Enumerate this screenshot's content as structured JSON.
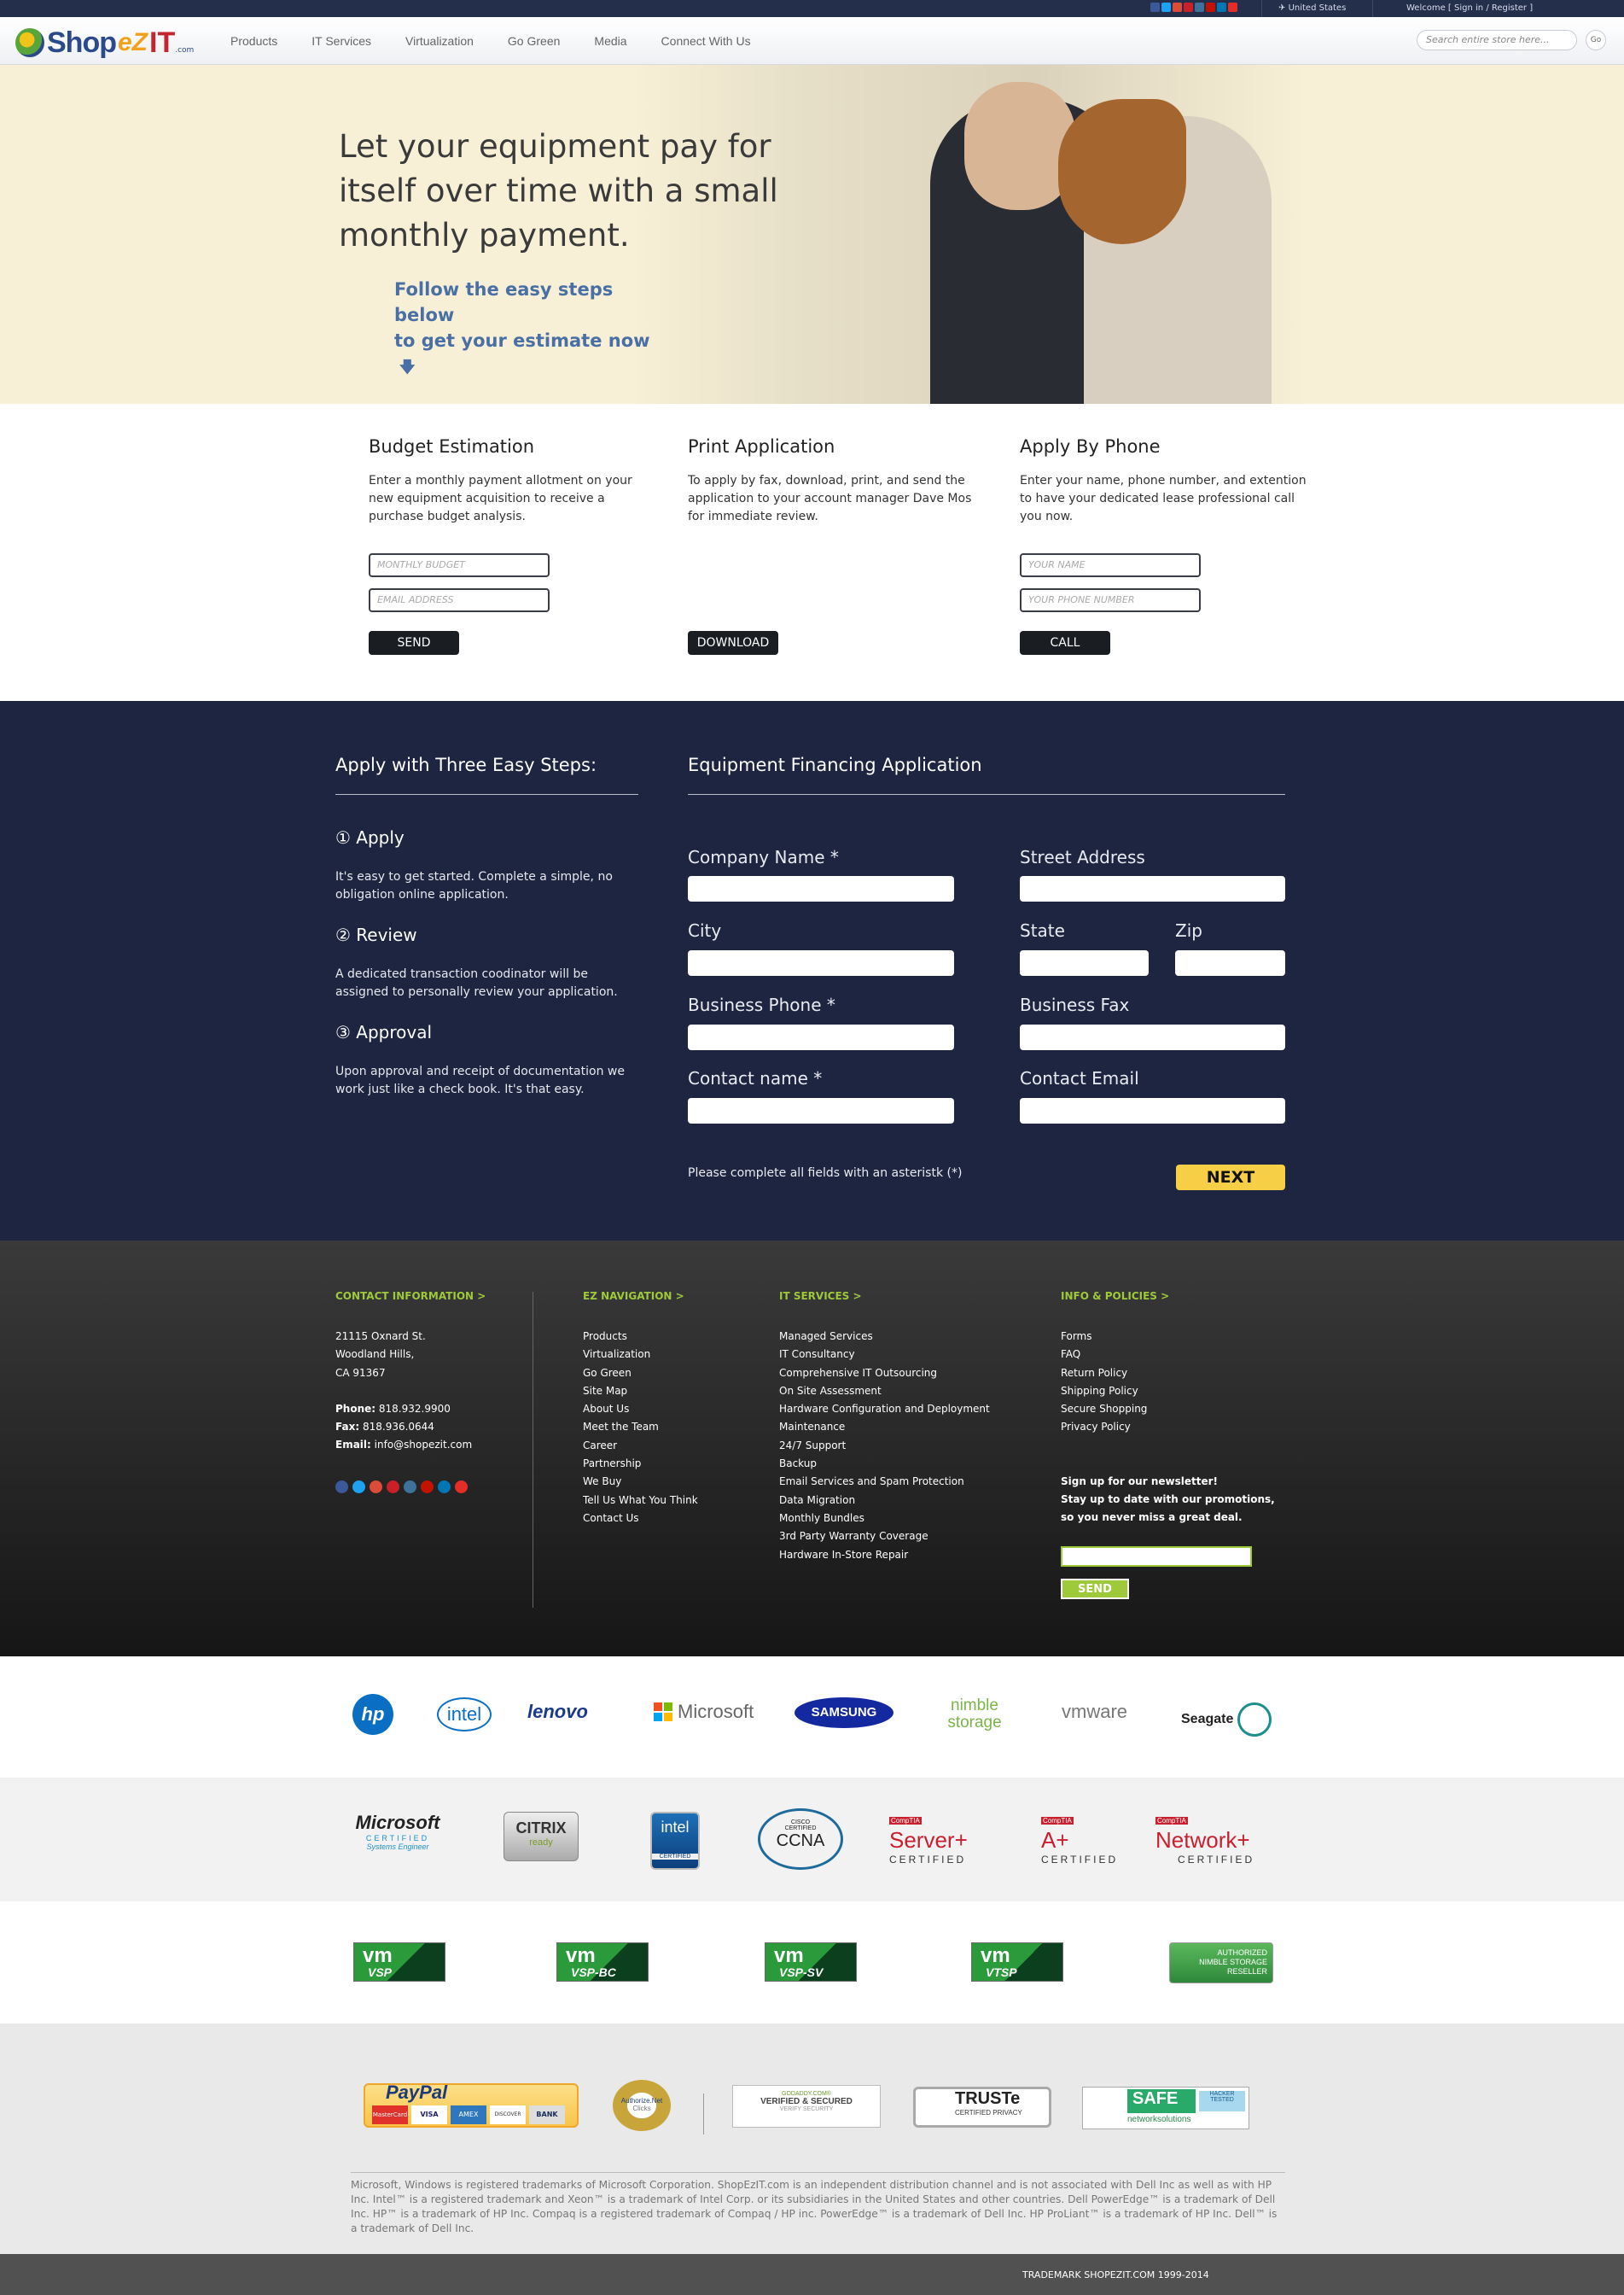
{
  "topbar": {
    "country": "United States",
    "welcome": "Welcome",
    "signin": "Sign in",
    "slash": "/",
    "register": "Register",
    "social_icons": [
      "facebook-icon",
      "twitter-icon",
      "google-plus-icon",
      "pinterest-icon",
      "instagram-icon",
      "yelp-icon",
      "linkedin-icon",
      "youtube-icon"
    ]
  },
  "header": {
    "logo_shop": "Shop",
    "logo_ez": "eZ",
    "logo_it": "IT",
    "logo_com": ".com",
    "nav": [
      "Products",
      "IT Services",
      "Virtualization",
      "Go Green",
      "Media",
      "Connect With Us"
    ],
    "search_placeholder": "Search entire store here...",
    "search_go": "Go"
  },
  "hero": {
    "headline": "Let your equipment pay for itself over time with a small monthly payment.",
    "subline_1": "Follow the easy steps below",
    "subline_2": "to get your estimate now",
    "arrow": "🡇"
  },
  "options": {
    "budget": {
      "title": "Budget Estimation",
      "text": "Enter a monthly payment allotment on your new equipment acquisition to receive a purchase budget analysis.",
      "budget_placeholder": "MONTHLY BUDGET",
      "email_placeholder": "EMAIL ADDRESS",
      "button": "SEND"
    },
    "print": {
      "title": "Print Application",
      "text": "To apply by fax, download, print, and send the application to your account manager Dave Mos for immediate review.",
      "button": "DOWNLOAD"
    },
    "phone": {
      "title": "Apply By Phone",
      "text": "Enter your name, phone number, and extention to have your dedicated lease professional call you now.",
      "name_placeholder": "YOUR NAME",
      "phone_placeholder": "YOUR PHONE NUMBER",
      "button": "CALL"
    }
  },
  "steps": {
    "heading": "Apply with Three Easy Steps:",
    "items": [
      {
        "title": "① Apply",
        "text": "It's easy to get started. Complete a simple, no obligation online application."
      },
      {
        "title": "② Review",
        "text": "A dedicated transaction coodinator will be assigned to personally review your application."
      },
      {
        "title": "③ Approval",
        "text": "Upon approval and receipt of documentation we work just like a check book. It's that easy."
      }
    ]
  },
  "application": {
    "heading": "Equipment Financing Application",
    "labels": {
      "company": "Company Name *",
      "street": "Street Address",
      "city": "City",
      "state": "State",
      "zip": "Zip",
      "phone": "Business Phone *",
      "fax": "Business Fax",
      "contact": "Contact name *",
      "email": "Contact Email"
    },
    "note": "Please complete all fields with an asteristk (*)",
    "next": "NEXT"
  },
  "footer": {
    "contact": {
      "heading": "CONTACT INFORMATION >",
      "address": [
        "21115 Oxnard St.",
        "Woodland Hills,",
        "CA 91367"
      ],
      "phone_label": "Phone:",
      "phone": "818.932.9900",
      "fax_label": "Fax:",
      "fax": "818.936.0644",
      "email_label": "Email:",
      "email": "info@shopezit.com"
    },
    "ez_nav": {
      "heading": "EZ NAVIGATION >",
      "items": [
        "Products",
        "Virtualization",
        "Go Green",
        "Site Map",
        "About Us",
        "Meet the Team",
        "Career",
        "Partnership",
        "We Buy",
        "Tell Us What You Think",
        "Contact Us"
      ]
    },
    "it_services": {
      "heading": "IT SERVICES >",
      "items": [
        "Managed Services",
        "IT Consultancy",
        "Comprehensive IT Outsourcing",
        "On Site Assessment",
        "Hardware Configuration and Deployment",
        "Maintenance",
        "24/7 Support",
        "Backup",
        "Email Services and Spam Protection",
        "Data Migration",
        "Monthly Bundles",
        "3rd Party Warranty Coverage",
        "Hardware In-Store Repair"
      ]
    },
    "info": {
      "heading": "INFO & POLICIES >",
      "items": [
        "Forms",
        "FAQ",
        "Return Policy",
        "Shipping Policy",
        "Secure Shopping",
        "Privacy Policy"
      ]
    },
    "newsletter": {
      "title": "Sign up for our newsletter!",
      "line1": "Stay up to date with our promotions,",
      "line2": "so you never miss a great deal.",
      "button": "SEND"
    }
  },
  "brands": [
    "hp",
    "intel",
    "lenovo",
    "Microsoft",
    "SAMSUNG",
    "nimble storage",
    "vmware",
    "Seagate"
  ],
  "certs": {
    "microsoft": "Microsoft",
    "microsoft_sub": "CERTIFIED",
    "microsoft_sub2": "Systems Engineer",
    "citrix": "CITRIX",
    "citrix_sub": "ready",
    "intel": "intel",
    "intel_sub": "CERTIFIED",
    "cisco_top": "CISCO CERTIFIED",
    "ccna": "CCNA",
    "comptia": "CompTIA",
    "server": "Server+",
    "aplus": "A+",
    "network": "Network+",
    "certified": "CERTIFIED"
  },
  "vmware_badges": [
    {
      "vm": "vm",
      "label": "VSP"
    },
    {
      "vm": "vm",
      "label": "VSP-BC"
    },
    {
      "vm": "vm",
      "label": "VSP-SV"
    },
    {
      "vm": "vm",
      "label": "VTSP"
    }
  ],
  "nimble_badge": {
    "line1": "AUTHORIZED",
    "line2": "NIMBLE STORAGE",
    "line3": "RESELLER"
  },
  "payments": {
    "paypal": "PayPal",
    "cards": [
      "MasterCard",
      "VISA",
      "AMEX",
      "DISCOVER",
      "BANK"
    ],
    "authorize": "Authorize.Net",
    "authorize_sub": "Clicks",
    "godaddy_top": "GODADDY.COM®",
    "godaddy": "VERIFIED & SECURED",
    "godaddy_sub": "VERIFY SECURITY",
    "truste": "TRUSTe",
    "truste_sub": "CERTIFIED PRIVACY",
    "safe": "SAFE",
    "safe_sub": "networksolutions",
    "safe_tag": "HACKER TESTED"
  },
  "legal": "Microsoft, Windows is registered trademarks of Microsoft Corporation. ShopEzIT.com is an independent distribution channel and is not associated with Dell Inc as well as with HP Inc. Intel™ is a registered trademark and Xeon™ is a trademark of Intel Corp. or its subsidiaries in the United States and other countries. Dell PowerEdge™ is a trademark of Dell Inc. HP™ is a trademark of HP Inc. Compaq is a registered trademark of Compaq / HP inc. PowerEdge™ is a trademark of Dell Inc. HP ProLiant™ is a trademark of HP Inc. Dell™ is a trademark of Dell Inc.",
  "copyright": "TRADEMARK SHOPEZIT.COM 1999-2014",
  "colors": {
    "navy": "#1e2540",
    "accent_green": "#9ec93a",
    "next_yellow": "#f7cf47",
    "hero_bg": "#f7f0d6"
  }
}
